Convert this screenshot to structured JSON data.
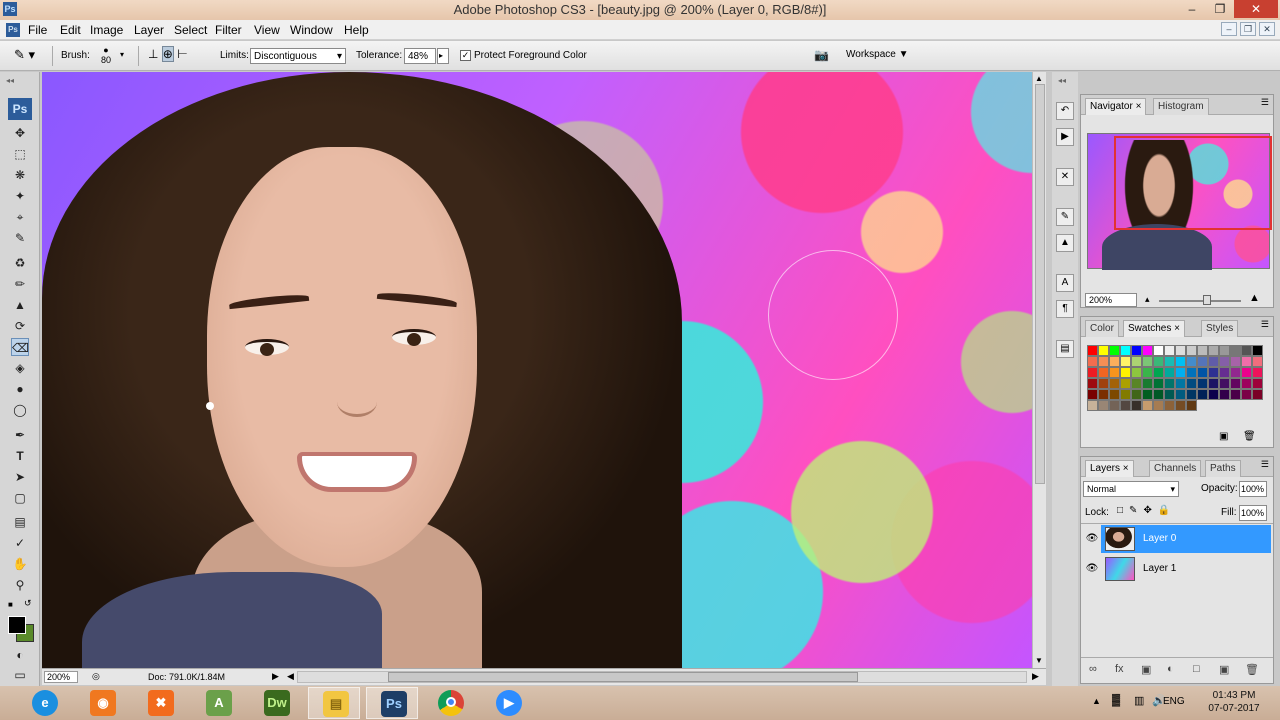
{
  "window": {
    "title": "Adobe Photoshop CS3 - [beauty.jpg @ 200% (Layer 0, RGB/8#)]",
    "app_icon": "Ps",
    "controls": [
      "minimize-icon",
      "restore-icon",
      "close-icon"
    ]
  },
  "menu": {
    "items": [
      "File",
      "Edit",
      "Image",
      "Layer",
      "Select",
      "Filter",
      "View",
      "Window",
      "Help"
    ]
  },
  "options": {
    "brush_label": "Brush:",
    "brush_size": "80",
    "limits_label": "Limits:",
    "limits_value": "Discontiguous",
    "tolerance_label": "Tolerance:",
    "tolerance_value": "48%",
    "protect_label": "Protect Foreground Color",
    "protect_checked": true,
    "workspace_label": "Workspace"
  },
  "toolbox": {
    "logo": "Ps",
    "tools": [
      "move-tool-icon",
      "marquee-tool-icon",
      "lasso-tool-icon",
      "quick-select-tool-icon",
      "crop-tool-icon",
      "eyedropper-tool-icon",
      "healing-brush-tool-icon",
      "brush-tool-icon",
      "clone-stamp-tool-icon",
      "history-brush-tool-icon",
      "background-eraser-tool-icon",
      "paint-bucket-tool-icon",
      "blur-tool-icon",
      "dodge-tool-icon",
      "pen-tool-icon",
      "type-tool-icon",
      "path-select-tool-icon",
      "shape-tool-icon",
      "notes-tool-icon",
      "eyedropper2-tool-icon",
      "hand-tool-icon",
      "zoom-tool-icon"
    ],
    "foreground_color": "#000000",
    "background_color": "#5a8a2a"
  },
  "status": {
    "zoom": "200%",
    "doc": "Doc: 791.0K/1.84M"
  },
  "navigator": {
    "tabs": [
      "Navigator",
      "Histogram"
    ],
    "zoom": "200%"
  },
  "color_panel": {
    "tabs": [
      "Color",
      "Swatches",
      "Styles"
    ],
    "swatch_colors": [
      "#ff0000",
      "#ffff00",
      "#00ff00",
      "#00ffff",
      "#0000ff",
      "#ff00ff",
      "#ffffff",
      "#eeeeee",
      "#dddddd",
      "#cccccc",
      "#bbbbbb",
      "#aaaaaa",
      "#999999",
      "#777777",
      "#555555",
      "#000000",
      "#f26c4f",
      "#f68e55",
      "#fbaf5c",
      "#fff467",
      "#acd372",
      "#7cc576",
      "#3bb878",
      "#1abbb4",
      "#00bff3",
      "#438ccb",
      "#5574b9",
      "#605ca8",
      "#855fa8",
      "#a763a8",
      "#f06ea9",
      "#f26d7d",
      "#ed1c24",
      "#f26522",
      "#f7941d",
      "#fff200",
      "#8dc63f",
      "#39b54a",
      "#00a651",
      "#00a99d",
      "#00aeef",
      "#0072bc",
      "#0054a6",
      "#2e3192",
      "#662d91",
      "#92278f",
      "#ec008c",
      "#ed145b",
      "#9e0b0f",
      "#a0410d",
      "#a36209",
      "#aba000",
      "#598527",
      "#197b30",
      "#007236",
      "#00746b",
      "#0076a3",
      "#004b80",
      "#003471",
      "#1b1464",
      "#440e62",
      "#630460",
      "#9e005d",
      "#9e0039",
      "#790000",
      "#7b2e00",
      "#7d4900",
      "#827b00",
      "#406618",
      "#005e20",
      "#005826",
      "#005952",
      "#005b7f",
      "#003663",
      "#002157",
      "#0d004c",
      "#32004b",
      "#4b0049",
      "#7b0046",
      "#7a0026",
      "#c7b299",
      "#998675",
      "#736357",
      "#534741",
      "#37302a",
      "#c69c6d",
      "#a67c52",
      "#8c6239",
      "#754c24",
      "#603913"
    ]
  },
  "layers_panel": {
    "tabs": [
      "Layers",
      "Channels",
      "Paths"
    ],
    "blend_mode": "Normal",
    "opacity_label": "Opacity:",
    "opacity_value": "100%",
    "lock_label": "Lock:",
    "fill_label": "Fill:",
    "fill_value": "100%",
    "layers": [
      {
        "name": "Layer 0",
        "selected": true
      },
      {
        "name": "Layer 1",
        "selected": false
      }
    ]
  },
  "taskbar": {
    "apps": [
      "ie-icon",
      "camera-app-icon",
      "xampp-icon",
      "android-studio-icon",
      "Dw",
      "file-explorer-icon",
      "Ps",
      "chrome-icon",
      "zoom-icon"
    ],
    "dw_label": "Dw",
    "ps_label": "Ps",
    "lang": "ENG",
    "time": "01:43 PM",
    "date": "07-07-2017"
  },
  "colors": {
    "selection_blue": "#3399ff",
    "titlebar": "#ecd0b8",
    "close_red": "#c84030"
  }
}
